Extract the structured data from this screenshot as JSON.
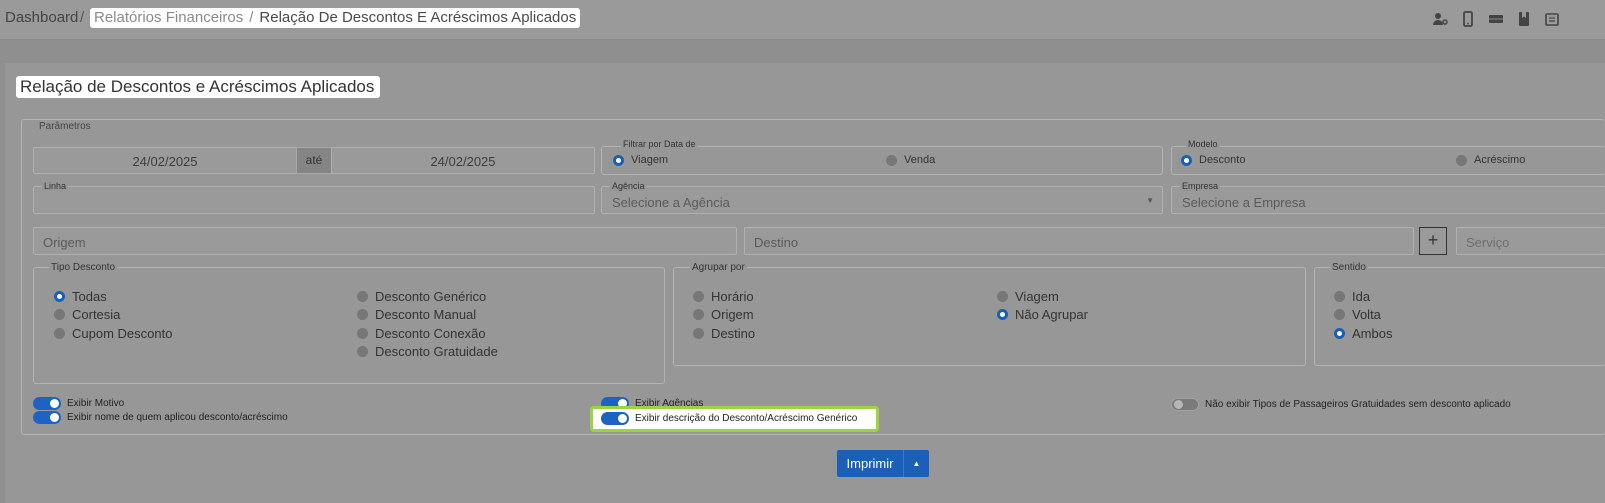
{
  "breadcrumb": {
    "home": "Dashboard",
    "separator": "/",
    "section": "Relatórios Financeiros",
    "current": "Relação De Descontos E Acréscimos Aplicados"
  },
  "page": {
    "title": "Relação de Descontos e Acréscimos Aplicados"
  },
  "parametros": {
    "legend": "Parâmetros",
    "date_from": "24/02/2025",
    "date_sep": "até",
    "date_to": "24/02/2025",
    "filtrar_data": {
      "label": "Filtrar por Data de",
      "viagem": "Viagem",
      "venda": "Venda",
      "selected": "Viagem"
    },
    "modelo": {
      "label": "Modelo",
      "desconto": "Desconto",
      "acrescimo": "Acréscimo",
      "selected": "Desconto"
    },
    "linha": {
      "label": "Linha",
      "value": ""
    },
    "agencia": {
      "label": "Agência",
      "placeholder": "Selecione a Agência"
    },
    "empresa": {
      "label": "Empresa",
      "placeholder": "Selecione a Empresa"
    },
    "origem": {
      "placeholder": "Origem"
    },
    "destino": {
      "placeholder": "Destino"
    },
    "plus": "+",
    "servico": {
      "placeholder": "Serviço"
    }
  },
  "tipo_desconto": {
    "label": "Tipo Desconto",
    "options": [
      "Todas",
      "Cortesia",
      "Cupom Desconto",
      "Desconto Genérico",
      "Desconto Manual",
      "Desconto Conexão",
      "Desconto Gratuidade"
    ],
    "selected": "Todas"
  },
  "agrupar_por": {
    "label": "Agrupar por",
    "options": [
      "Horário",
      "Origem",
      "Destino",
      "Viagem",
      "Não Agrupar"
    ],
    "selected": "Não Agrupar"
  },
  "sentido": {
    "label": "Sentido",
    "options": [
      "Ida",
      "Volta",
      "Ambos"
    ],
    "selected": "Ambos"
  },
  "toggles": {
    "exibir_motivo": {
      "label": "Exibir Motivo",
      "on": true
    },
    "exibir_nome": {
      "label": "Exibir nome de quem aplicou desconto/acréscimo",
      "on": true
    },
    "exibir_agencias": {
      "label": "Exibir Agências",
      "on": true
    },
    "exibir_descricao": {
      "label": "Exibir descrição do Desconto/Acréscimo Genérico",
      "on": true
    },
    "nao_exibir_tipos": {
      "label": "Não exibir Tipos de Passageiros Gratuidades sem desconto aplicado",
      "on": false
    }
  },
  "actions": {
    "print": "Imprimir",
    "print_menu_icon": "caret-up"
  },
  "colors": {
    "accent": "#1b5fb8",
    "highlight": "#9bd440"
  },
  "top_icons": [
    "user-key-icon",
    "mobile-icon",
    "ticket-icon",
    "bookmark-icon",
    "document-icon"
  ]
}
